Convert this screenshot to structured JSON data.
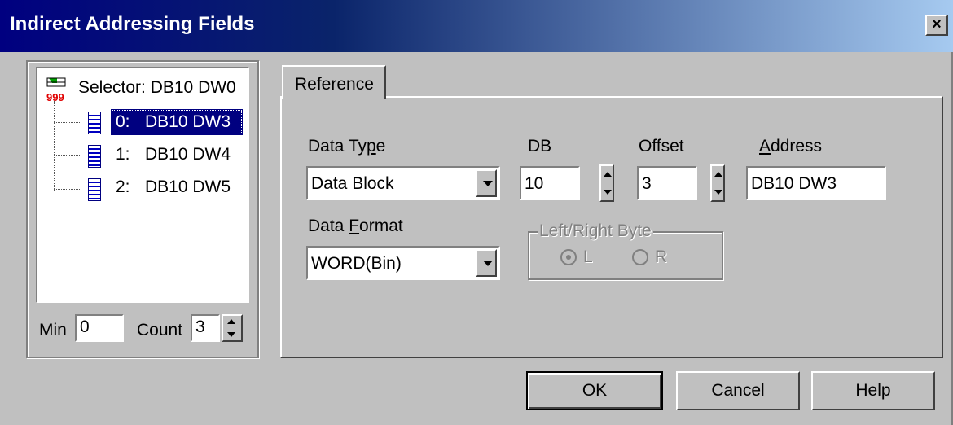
{
  "window": {
    "title": "Indirect Addressing Fields",
    "close_label": "×"
  },
  "tree": {
    "root": "Selector: DB10 DW0",
    "items": [
      {
        "index": "0:",
        "value": "DB10 DW3",
        "selected": true
      },
      {
        "index": "1:",
        "value": "DB10 DW4",
        "selected": false
      },
      {
        "index": "2:",
        "value": "DB10 DW5",
        "selected": false
      }
    ]
  },
  "min": {
    "label": "Min",
    "value": "0"
  },
  "count": {
    "label": "Count",
    "value": "3"
  },
  "tab": {
    "label": "Reference"
  },
  "fields": {
    "data_type": {
      "label": "Data Type",
      "value": "Data Block"
    },
    "db": {
      "label": "DB",
      "value": "10"
    },
    "offset": {
      "label": "Offset",
      "value": "3"
    },
    "address": {
      "label": "Address",
      "value": "DB10 DW3"
    },
    "data_format": {
      "label": "Data Format",
      "value": "WORD(Bin)"
    },
    "byte_group": {
      "label": "Left/Right Byte",
      "left": "L",
      "right": "R"
    }
  },
  "buttons": {
    "ok": "OK",
    "cancel": "Cancel",
    "help": "Help"
  },
  "colors": {
    "title_bar": "#000080",
    "selection": "#000080",
    "face": "#c0c0c0"
  }
}
